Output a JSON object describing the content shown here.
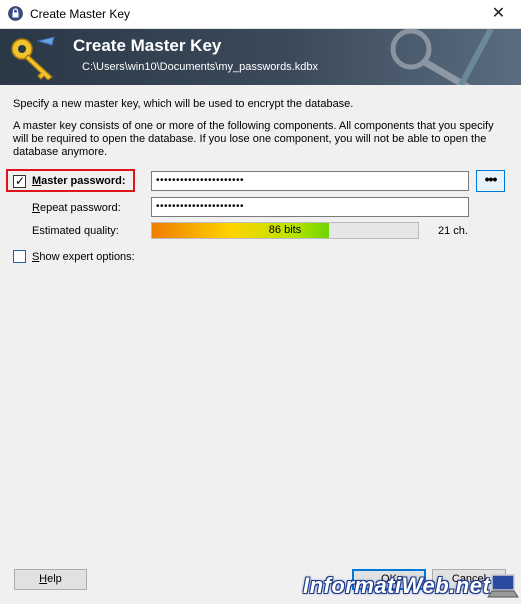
{
  "window": {
    "title": "Create Master Key",
    "close_icon": "close-icon"
  },
  "banner": {
    "title": "Create Master Key",
    "subtitle": "C:\\Users\\win10\\Documents\\my_passwords.kdbx"
  },
  "intro": {
    "line1": "Specify a new master key, which will be used to encrypt the database.",
    "line2": "A master key consists of one or more of the following components. All components that you specify will be required to open the database. If you lose one component, you will not be able to open the database anymore."
  },
  "master_password": {
    "checked": true,
    "label_accel": "M",
    "label_rest": "aster password:",
    "value": "••••••••••••••••••••••",
    "show_button": "•••"
  },
  "repeat_password": {
    "label_accel": "R",
    "label_rest": "epeat password:",
    "value": "••••••••••••••••••••••"
  },
  "quality": {
    "label": "Estimated quality:",
    "bits_text": "86 bits",
    "level": 0.665,
    "chars_text": "21 ch."
  },
  "expert": {
    "checked": false,
    "label_accel": "S",
    "label_rest": "how expert options:"
  },
  "buttons": {
    "help_accel": "H",
    "help_rest": "elp",
    "ok": "OK",
    "cancel": "Cancel"
  },
  "watermark": "InformatiWeb.net",
  "colors": {
    "highlight": "#e0141c",
    "accent": "#0078d7",
    "banner": "#2a3846"
  }
}
